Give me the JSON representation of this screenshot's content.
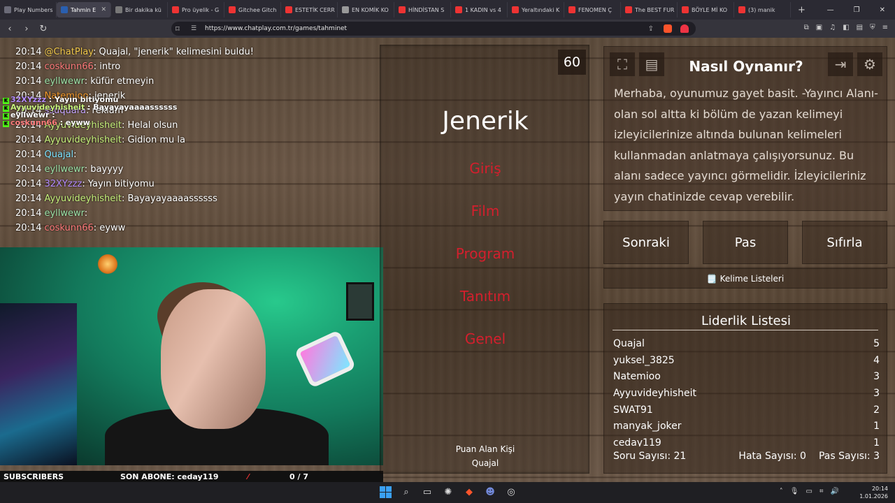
{
  "tabs": [
    {
      "label": "Play Numbers",
      "color": "#6b6b78"
    },
    {
      "label": "Tahmin E",
      "color": "#2a5fb0",
      "active": true
    },
    {
      "label": "Bir dakika kü",
      "color": "#777"
    },
    {
      "label": "Pro üyelik - G",
      "color": "#e33"
    },
    {
      "label": "Gitchee Gitch",
      "color": "#e33"
    },
    {
      "label": "ESTETİK CERR",
      "color": "#e33"
    },
    {
      "label": "EN KOMİK KO",
      "color": "#999"
    },
    {
      "label": "HİNDİSTAN S",
      "color": "#e33"
    },
    {
      "label": "1 KADIN vs 4",
      "color": "#e33"
    },
    {
      "label": "Yeraltındaki K",
      "color": "#e33"
    },
    {
      "label": "FENOMEN Ç",
      "color": "#e33"
    },
    {
      "label": "The BEST FUR",
      "color": "#e33"
    },
    {
      "label": "BÖYLE Mİ KO",
      "color": "#e33"
    },
    {
      "label": "(3) manik",
      "color": "#e33"
    }
  ],
  "browser": {
    "url": "https://www.chatplay.com.tr/games/tahminet",
    "new_tab": "+",
    "min": "—",
    "max": "❐",
    "close": "✕"
  },
  "chat": [
    {
      "time": "20:14",
      "user": "@ChatPlay",
      "color": "#f2c94c",
      "msg": ": Quajal, \"jenerik\" kelimesini buldu!"
    },
    {
      "time": "20:14",
      "user": "coskunn66",
      "color": "#ff7b7b",
      "msg": ": intro"
    },
    {
      "time": "20:14",
      "user": "eyllwewr",
      "color": "#9de3a8",
      "msg": ": küfür etmeyin"
    },
    {
      "time": "20:14",
      "user": "Natemioo",
      "color": "#f59a2a",
      "msg": ": jenerik"
    },
    {
      "time": "20:14",
      "user": "ssuquara",
      "color": "#c7a7ff",
      "msg": ": reklam"
    },
    {
      "time": "20:14",
      "user": "Ayyuvideyhisheit",
      "color": "#c7f27c",
      "msg": ": Helal olsun"
    },
    {
      "time": "20:14",
      "user": "Ayyuvideyhisheit",
      "color": "#c7f27c",
      "msg": ": Gidion mu la"
    },
    {
      "time": "20:14",
      "user": "Quajal",
      "color": "#7de3ff",
      "msg": ": "
    },
    {
      "time": "20:14",
      "user": "eyllwewr",
      "color": "#9de3a8",
      "msg": ": bayyyy"
    },
    {
      "time": "20:14",
      "user": "32XYzzz",
      "color": "#b58cff",
      "msg": ": Yayın bitiyomu"
    },
    {
      "time": "20:14",
      "user": "Ayyuvideyhisheit",
      "color": "#c7f27c",
      "msg": ": Bayayayaaaassssss"
    },
    {
      "time": "20:14",
      "user": "eyllwewr",
      "color": "#9de3a8",
      "msg": ": "
    },
    {
      "time": "20:14",
      "user": "coskunn66",
      "color": "#ff7b7b",
      "msg": ": eyww"
    }
  ],
  "overlay_chat": [
    {
      "user": "32XYzzz",
      "color": "#b58cff",
      "msg": " : Yayın bitiyomu"
    },
    {
      "user": "Ayyuvideyhisheit",
      "color": "#c7f27c",
      "msg": " : Bayayayaaaassssss"
    },
    {
      "user": "eyllwewr",
      "color": "#fff",
      "msg": " : "
    },
    {
      "user": "coskunn66",
      "color": "#ff7b7b",
      "msg": " : eyww"
    }
  ],
  "stream_overlay": {
    "subscribers_label": "SUBSCRIBERS",
    "last_sub_label": "SON ABONE: ceday119",
    "sub_count": "0  / 7"
  },
  "game": {
    "timer": "60",
    "word": "Jenerik",
    "forbidden_words": [
      "Giriş",
      "Film",
      "Program",
      "Tanıtım",
      "Genel"
    ],
    "scorer_label": "Puan Alan Kişi",
    "scorer_name": "Quajal"
  },
  "howto": {
    "title": "Nasıl Oynanır?",
    "body": "Merhaba, oyunumuz gayet basit. -Yayıncı Alanı- olan sol altta ki bölüm de yazan kelimeyi izleyicilerinize altında bulunan kelimeleri kullanmadan anlatmaya çalışıyorsunuz. Bu alanı sadece yayıncı görmelidir. İzleyicileriniz yayın chatinizde cevap verebilir."
  },
  "controls": {
    "next": "Sonraki",
    "pass": "Pas",
    "reset": "Sıfırla",
    "word_lists": "🗒️ Kelime Listeleri"
  },
  "leaderboard": {
    "title": "Liderlik Listesi",
    "rows": [
      {
        "name": "Quajal",
        "score": "5"
      },
      {
        "name": "yuksel_3825",
        "score": "4"
      },
      {
        "name": "Natemioo",
        "score": "3"
      },
      {
        "name": "Ayyuvideyhisheit",
        "score": "3"
      },
      {
        "name": "SWAT91",
        "score": "2"
      },
      {
        "name": "manyak_joker",
        "score": "1"
      },
      {
        "name": "ceday119",
        "score": "1"
      }
    ],
    "question_count": "Soru Sayısı: 21",
    "error_count": "Hata Sayısı: 0",
    "pass_count": "Pas Sayısı: 3"
  },
  "taskbar": {
    "time": "20:14",
    "date": "1.01.2026"
  }
}
